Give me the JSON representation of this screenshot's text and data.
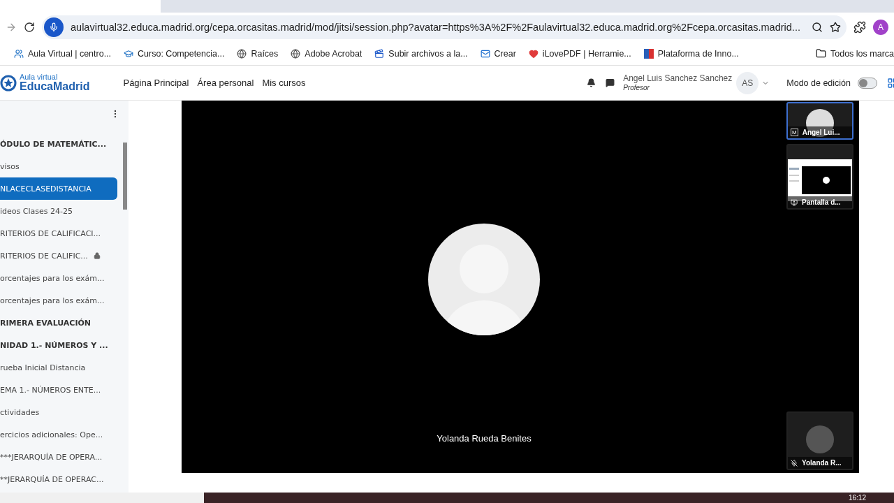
{
  "browser": {
    "url": "aulavirtual32.educa.madrid.org/cepa.orcasitas.madrid/mod/jitsi/session.php?avatar=https%3A%2F%2Faulavirtual32.educa.madrid.org%2Fcepa.orcasitas.madrid...",
    "profile_initial": "A",
    "bookmarks": [
      {
        "label": "Aula Virtual | centro...",
        "kind": "people"
      },
      {
        "label": "Curso: Competencia...",
        "kind": "cap"
      },
      {
        "label": "Raíces",
        "kind": "globe"
      },
      {
        "label": "Adobe Acrobat",
        "kind": "globe"
      },
      {
        "label": "Subir archivos a la...",
        "kind": "clapper"
      },
      {
        "label": "Crear",
        "kind": "mail"
      },
      {
        "label": "iLovePDF | Herramie...",
        "kind": "heart"
      },
      {
        "label": "Plataforma de Inno...",
        "kind": "flag"
      }
    ],
    "all_bookmarks": "Todos los marca"
  },
  "site": {
    "logo_small": "Aula virtual",
    "logo_big": "EducaMadrid",
    "nav": [
      "Página Principal",
      "Área personal",
      "Mis cursos"
    ],
    "user": {
      "name": "Angel Luis Sanchez Sanchez",
      "role": "Profesor",
      "initials": "AS"
    },
    "edit_mode": {
      "label": "Modo de edición",
      "on": false
    }
  },
  "sidebar": {
    "items": [
      {
        "label": "ÓDULO DE MATEMÁTIC...",
        "kind": "section",
        "selected": false,
        "locked": false
      },
      {
        "label": "visos",
        "kind": "item",
        "selected": false,
        "locked": false
      },
      {
        "label": "NLACECLASEDISTANCIA",
        "kind": "item",
        "selected": true,
        "locked": false
      },
      {
        "label": "ideos Clases 24-25",
        "kind": "item",
        "selected": false,
        "locked": false
      },
      {
        "label": "RITERIOS DE CALIFICACI...",
        "kind": "item",
        "selected": false,
        "locked": false
      },
      {
        "label": "RITERIOS DE CALIFIC...",
        "kind": "item",
        "selected": false,
        "locked": true
      },
      {
        "label": "orcentajes para los exám...",
        "kind": "item",
        "selected": false,
        "locked": false
      },
      {
        "label": "orcentajes para los exám...",
        "kind": "item",
        "selected": false,
        "locked": false
      },
      {
        "label": "RIMERA EVALUACIÓN",
        "kind": "section",
        "selected": false,
        "locked": false
      },
      {
        "label": "NIDAD 1.- NÚMEROS Y ...",
        "kind": "section",
        "selected": false,
        "locked": false
      },
      {
        "label": "rueba Inicial Distancia",
        "kind": "item",
        "selected": false,
        "locked": false
      },
      {
        "label": "EMA 1.- NÚMEROS ENTE...",
        "kind": "item",
        "selected": false,
        "locked": false
      },
      {
        "label": "ctividades",
        "kind": "item",
        "selected": false,
        "locked": false
      },
      {
        "label": "ercicios adicionales: Ope...",
        "kind": "item",
        "selected": false,
        "locked": false
      },
      {
        "label": "***JERARQUÍA DE OPERA...",
        "kind": "item",
        "selected": false,
        "locked": false
      },
      {
        "label": "**JERARQUÍA DE OPERAC...",
        "kind": "item",
        "selected": false,
        "locked": false
      }
    ]
  },
  "meeting": {
    "speaker": "Yolanda Rueda Benites",
    "thumbnails": [
      {
        "name": "Angel Lui...",
        "kind": "moderator",
        "badge": "M",
        "selected": true
      },
      {
        "name": "Pantalla d...",
        "kind": "screen",
        "selected": false
      },
      {
        "name": "Yolanda R...",
        "kind": "muted",
        "selected": false
      }
    ]
  },
  "taskbar": {
    "time": "16:12"
  }
}
